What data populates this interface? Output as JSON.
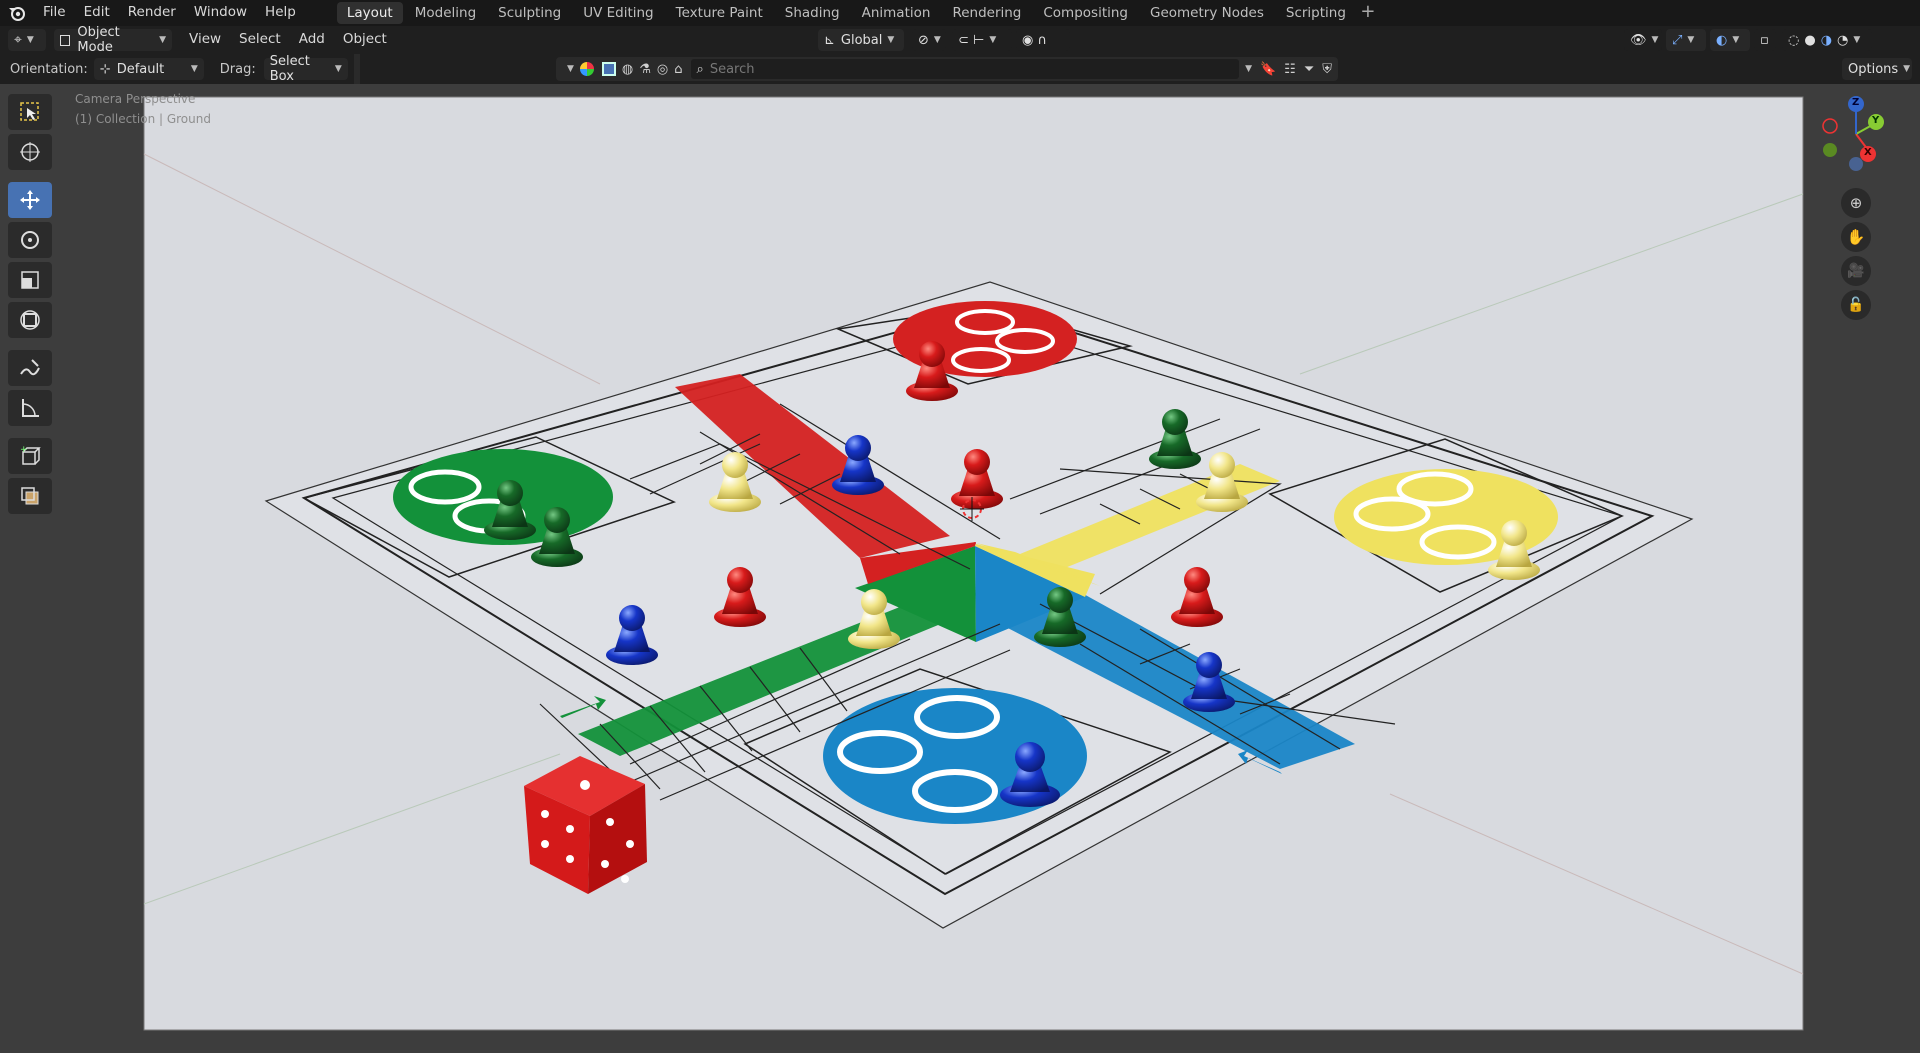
{
  "menu": {
    "items": [
      "File",
      "Edit",
      "Render",
      "Window",
      "Help"
    ]
  },
  "workspaces": {
    "tabs": [
      "Layout",
      "Modeling",
      "Sculpting",
      "UV Editing",
      "Texture Paint",
      "Shading",
      "Animation",
      "Rendering",
      "Compositing",
      "Geometry Nodes",
      "Scripting"
    ],
    "active": "Layout",
    "add_symbol": "+"
  },
  "header": {
    "mode": "Object Mode",
    "view": "View",
    "select": "Select",
    "add": "Add",
    "object": "Object",
    "transform_orientation": "Global"
  },
  "tool_settings": {
    "orientation_label": "Orientation:",
    "orientation_value": "Default",
    "drag_label": "Drag:",
    "drag_value": "Select Box",
    "search_placeholder": "Search",
    "options": "Options"
  },
  "viewport": {
    "camera_text": "Camera Perspective",
    "collection_text": "(1) Collection | Ground",
    "axis_x": "X",
    "axis_y": "Y",
    "axis_z": "Z"
  },
  "colors": {
    "accent_blue": "#4772b3",
    "ludo_red": "#d42121",
    "ludo_green": "#13913a",
    "ludo_yellow": "#efe15f",
    "ludo_blue": "#1a86c7",
    "board_bg": "#d9dbe0"
  },
  "icons": {
    "logo": "blender-logo-icon",
    "tools": [
      "select-box-icon",
      "cursor-icon",
      "move-icon",
      "rotate-icon",
      "scale-icon",
      "transform-icon",
      "annotate-icon",
      "measure-icon",
      "add-cube-icon",
      "extrude-icon"
    ]
  }
}
